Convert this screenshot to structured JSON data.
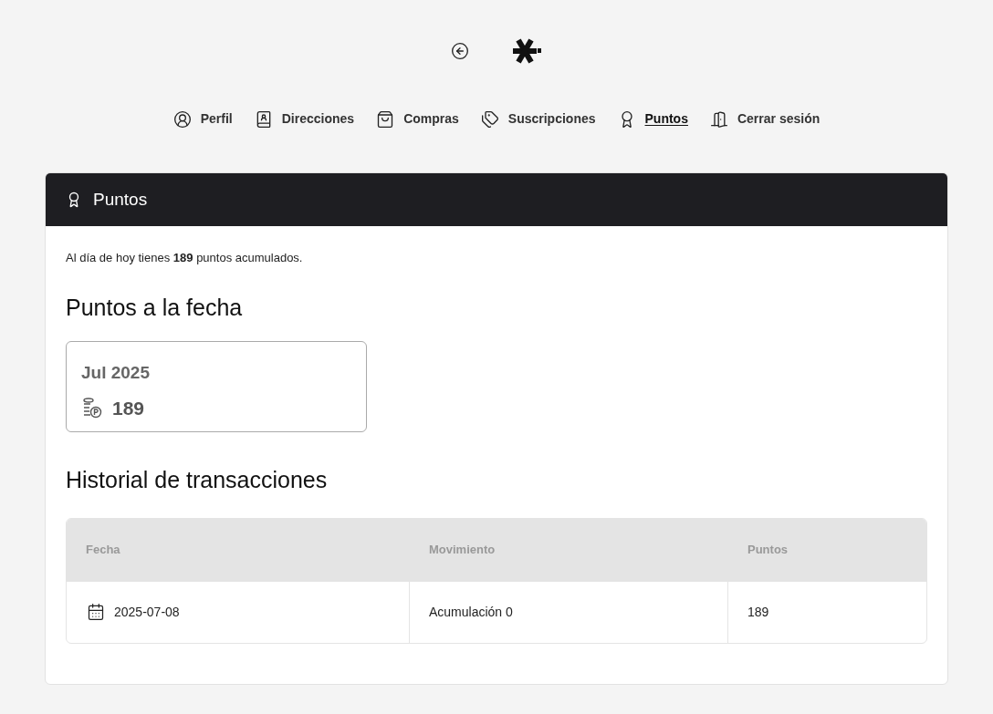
{
  "nav": [
    {
      "label": "Perfil",
      "kind": "profile",
      "selected": false
    },
    {
      "label": "Direcciones",
      "kind": "contacts",
      "selected": false
    },
    {
      "label": "Compras",
      "kind": "bag",
      "selected": false
    },
    {
      "label": "Suscripciones",
      "kind": "tags",
      "selected": false
    },
    {
      "label": "Puntos",
      "kind": "award",
      "selected": true
    },
    {
      "label": "Cerrar sesión",
      "kind": "door",
      "selected": false
    }
  ],
  "panel": {
    "title": "Puntos",
    "summary": "Al día de hoy tienes **189** puntos acumulados.",
    "balance_heading": "Puntos a la fecha",
    "balance_card": {
      "period": "Jul 2025",
      "points": "189"
    },
    "history_heading": "Historial de transacciones",
    "table": {
      "columns": [
        "Fecha",
        "Movimiento",
        "Puntos"
      ],
      "rows": [
        {
          "date": "2025-07-08",
          "movement": "Acumulación 0",
          "points": "189"
        }
      ]
    }
  }
}
